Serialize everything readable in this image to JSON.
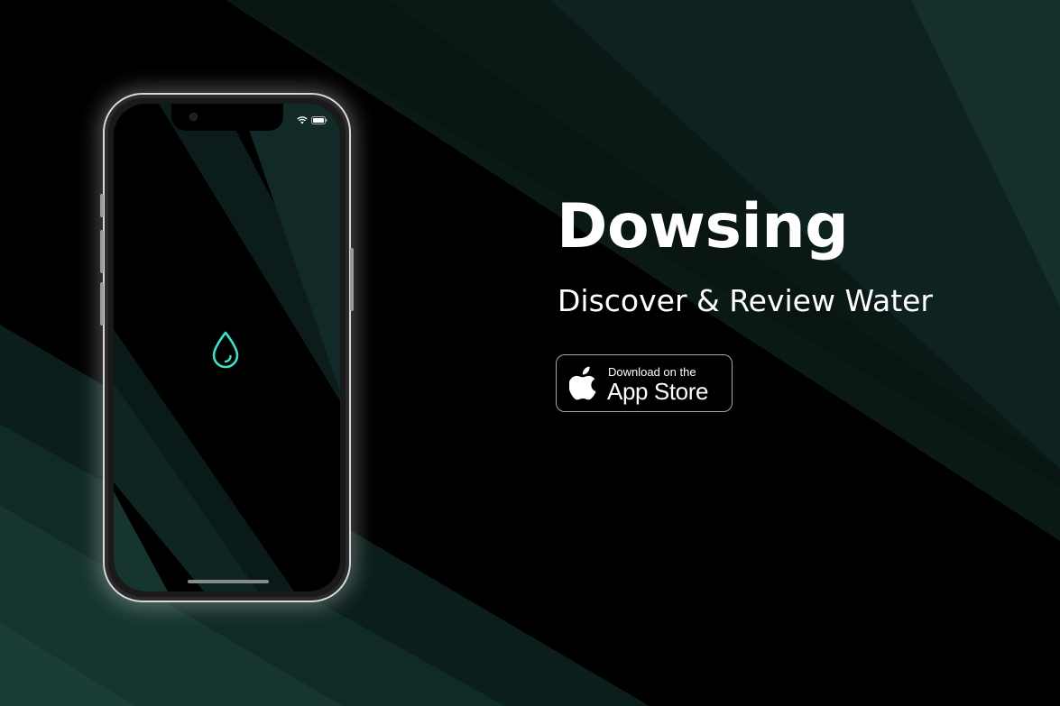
{
  "app": {
    "title": "Dowsing",
    "tagline": "Discover & Review Water"
  },
  "store_badge": {
    "line1": "Download on the",
    "line2": "App Store",
    "icon": "apple-icon"
  },
  "phone": {
    "center_icon": "water-drop-icon",
    "status_icons": [
      "wifi-icon",
      "battery-icon"
    ]
  },
  "colors": {
    "background": "#000000",
    "accent_teal": "#1f3a36",
    "drop_icon": "#3fe0c8",
    "text": "#ffffff"
  }
}
